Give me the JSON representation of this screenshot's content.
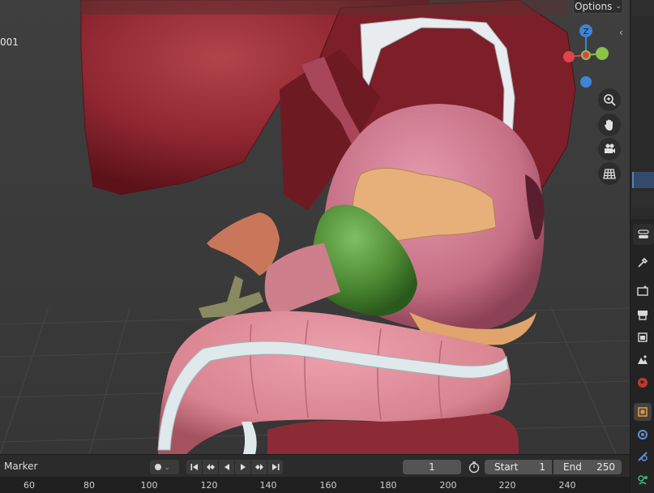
{
  "viewport": {
    "frame_label": "001",
    "options_label": "Options",
    "nav_icons": [
      "zoom-icon",
      "pan-hand-icon",
      "camera-icon",
      "grid-ortho-icon"
    ],
    "gizmo": {
      "z_label": "Z",
      "colors": {
        "x": "#e0434e",
        "y": "#8bc34a",
        "z": "#3d85d6"
      }
    }
  },
  "timeline": {
    "marker_label": "Marker",
    "current_frame": "1",
    "start_label": "Start",
    "start_value": "1",
    "end_label": "End",
    "end_value": "250",
    "playback_icons": [
      "jump-start-icon",
      "prev-keyframe-icon",
      "play-reverse-icon",
      "play-icon",
      "next-keyframe-icon",
      "jump-end-icon"
    ]
  },
  "ruler": {
    "ticks": [
      "60",
      "80",
      "100",
      "120",
      "140",
      "160",
      "180",
      "200",
      "220",
      "240"
    ]
  },
  "side_panel": {
    "tabs": [
      "tool-icon",
      "render-icon",
      "output-icon",
      "view-layer-icon",
      "scene-icon",
      "world-icon",
      "object-icon",
      "modifier-icon",
      "particles-icon",
      "physics-icon"
    ]
  },
  "colors": {
    "accent": "#5a7fbf",
    "viewport_bg": "#3d3d3d",
    "liver": "#8e2630",
    "stomach": "#c66f84",
    "gallbladder": "#4e8a34",
    "pancreas": "#e7b07a",
    "colon": "#d98491"
  }
}
